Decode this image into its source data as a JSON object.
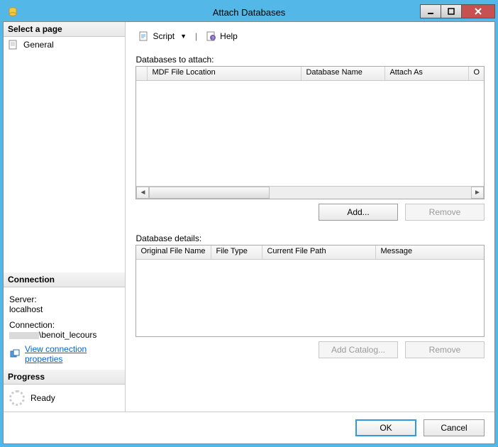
{
  "window": {
    "title": "Attach Databases"
  },
  "sidebar": {
    "select_page_header": "Select a page",
    "page_general": "General",
    "connection_header": "Connection",
    "server_label": "Server:",
    "server_value": "localhost",
    "connection_label": "Connection:",
    "connection_user": "\\benoit_lecours",
    "view_props_link": "View connection properties",
    "progress_header": "Progress",
    "progress_status": "Ready"
  },
  "toolbar": {
    "script_label": "Script",
    "help_label": "Help"
  },
  "main": {
    "databases_to_attach_label": "Databases to attach:",
    "grid1_cols": {
      "mdf": "MDF File Location",
      "dbname": "Database Name",
      "attach_as": "Attach As",
      "owner_initial": "O"
    },
    "add_label": "Add...",
    "remove1_label": "Remove",
    "database_details_label": "Database details:",
    "grid2_cols": {
      "orig": "Original File Name",
      "ftype": "File Type",
      "curpath": "Current File Path",
      "msg": "Message"
    },
    "add_catalog_label": "Add Catalog...",
    "remove2_label": "Remove"
  },
  "footer": {
    "ok": "OK",
    "cancel": "Cancel"
  }
}
